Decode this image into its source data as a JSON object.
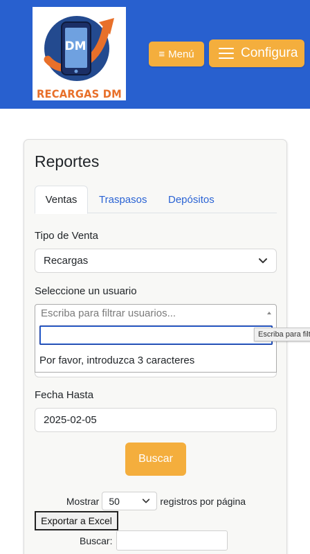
{
  "header": {
    "logo_text": "RECARGAS DM",
    "logo_badge": "DM",
    "menu_button": "Menú",
    "config_button": "Configura",
    "colors": {
      "header_bg": "#2860cf",
      "accent_button": "#f4ae3d",
      "logo_orange": "#e8702a"
    }
  },
  "report": {
    "title": "Reportes",
    "tabs": [
      {
        "label": "Ventas",
        "active": true
      },
      {
        "label": "Traspasos",
        "active": false
      },
      {
        "label": "Depósitos",
        "active": false
      }
    ],
    "tipo_venta_label": "Tipo de Venta",
    "tipo_venta_value": "Recargas",
    "usuario_label": "Seleccione un usuario",
    "usuario_placeholder": "Escriba para filtrar usuarios...",
    "usuario_search_value": "",
    "usuario_message": "Por favor, introduzca 3 caracteres",
    "tooltip_text": "Escriba para filt",
    "fecha_hasta_label": "Fecha Hasta",
    "fecha_hasta_value": "2025-02-05",
    "buscar_button": "Buscar"
  },
  "table_controls": {
    "show_label": "Mostrar",
    "page_size": "50",
    "per_page_label": "registros por página",
    "export_button": "Exportar a Excel",
    "search_label": "Buscar:",
    "search_value": ""
  }
}
